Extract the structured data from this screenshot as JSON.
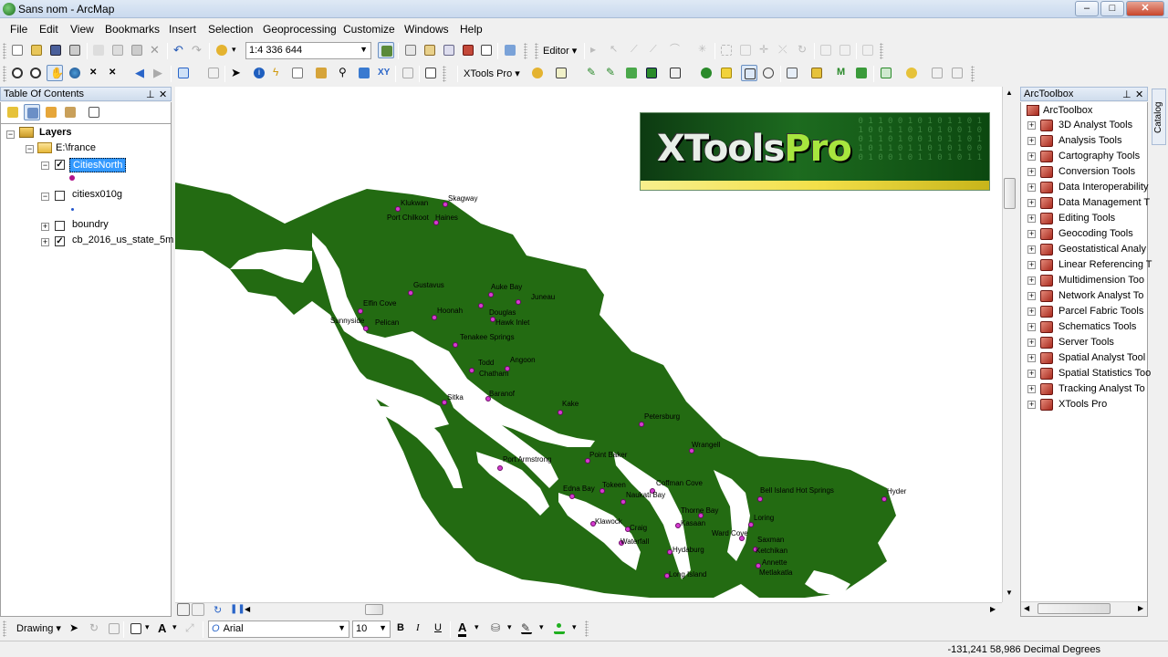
{
  "window": {
    "title": "Sans nom - ArcMap",
    "min": "–",
    "max": "□",
    "close": "✕"
  },
  "menu": [
    "File",
    "Edit",
    "View",
    "Bookmarks",
    "Insert",
    "Selection",
    "Geoprocessing",
    "Customize",
    "Windows",
    "Help"
  ],
  "toolbar": {
    "scale": "1:4 336 644",
    "editor_label": "Editor",
    "xtools_label": "XTools Pro"
  },
  "toc": {
    "title": "Table Of Contents",
    "root": "Layers",
    "folder": "E:\\france",
    "layers": [
      {
        "name": "CitiesNorth",
        "checked": true,
        "selected": true
      },
      {
        "name": "citiesx010g",
        "checked": false
      },
      {
        "name": "boundry",
        "checked": false
      },
      {
        "name": "cb_2016_us_state_5m",
        "checked": true
      }
    ]
  },
  "map": {
    "land_color": "#236b12",
    "city_color": "#d63bd0",
    "logo_text": "XTools",
    "logo_accent": "Pro",
    "cities": [
      {
        "name": "Klukwan"
      },
      {
        "name": "Skagway"
      },
      {
        "name": "Port Chilkoot"
      },
      {
        "name": "Haines"
      },
      {
        "name": "Gustavus"
      },
      {
        "name": "Auke Bay"
      },
      {
        "name": "Elfin Cove"
      },
      {
        "name": "Hoonah"
      },
      {
        "name": "Douglas"
      },
      {
        "name": "Juneau"
      },
      {
        "name": "Hawk Inlet"
      },
      {
        "name": "Sunnyside"
      },
      {
        "name": "Pelican"
      },
      {
        "name": "Tenakee Springs"
      },
      {
        "name": "Todd"
      },
      {
        "name": "Chatham"
      },
      {
        "name": "Angoon"
      },
      {
        "name": "Sitka"
      },
      {
        "name": "Baranof"
      },
      {
        "name": "Kake"
      },
      {
        "name": "Petersburg"
      },
      {
        "name": "Port Armstrong"
      },
      {
        "name": "Point Baker"
      },
      {
        "name": "Wrangell"
      },
      {
        "name": "Coffman Cove"
      },
      {
        "name": "Tokeen"
      },
      {
        "name": "Edna Bay"
      },
      {
        "name": "Naukati Bay"
      },
      {
        "name": "Bell Island Hot Springs"
      },
      {
        "name": "Hyder"
      },
      {
        "name": "Thorne Bay"
      },
      {
        "name": "Kasaan"
      },
      {
        "name": "Klawock"
      },
      {
        "name": "Craig"
      },
      {
        "name": "Waterfall"
      },
      {
        "name": "Loring"
      },
      {
        "name": "Ward Cove"
      },
      {
        "name": "Saxman"
      },
      {
        "name": "Ketchikan"
      },
      {
        "name": "Hydaburg"
      },
      {
        "name": "Annette"
      },
      {
        "name": "Metlakatla"
      },
      {
        "name": "Long Island"
      }
    ]
  },
  "toolbox": {
    "title": "ArcToolbox",
    "root": "ArcToolbox",
    "items": [
      "3D Analyst Tools",
      "Analysis Tools",
      "Cartography Tools",
      "Conversion Tools",
      "Data Interoperability",
      "Data Management T",
      "Editing Tools",
      "Geocoding Tools",
      "Geostatistical Analy",
      "Linear Referencing T",
      "Multidimension Too",
      "Network Analyst To",
      "Parcel Fabric Tools",
      "Schematics Tools",
      "Server Tools",
      "Spatial Analyst Tool",
      "Spatial Statistics Too",
      "Tracking Analyst To",
      "XTools Pro"
    ]
  },
  "catalog_tab": "Catalog",
  "drawing": {
    "label": "Drawing",
    "font": "Arial",
    "size": "10",
    "bold": "B",
    "italic": "I",
    "underline": "U",
    "font_color": "A"
  },
  "status": {
    "coords": "-131,241  58,986 Decimal Degrees"
  }
}
